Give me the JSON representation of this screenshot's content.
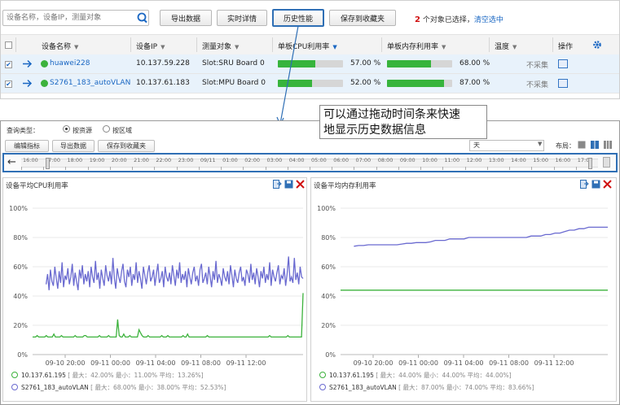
{
  "toolbar": {
    "search_placeholder": "设备名称，设备IP，测量对象",
    "export_label": "导出数据",
    "realtime_label": "实时详情",
    "history_label": "历史性能",
    "favorite_label": "保存到收藏夹",
    "selected_count": "2",
    "selected_text": " 个对象已选择，",
    "clear_label": "清空选中"
  },
  "table": {
    "columns": [
      "设备名称",
      "设备IP",
      "测量对象",
      "单板CPU利用率",
      "单板内存利用率",
      "温度",
      "操作"
    ],
    "rows": [
      {
        "name": "huawei228",
        "ip": "10.137.59.228",
        "object": "Slot:SRU Board 0",
        "cpu": "57.00 %",
        "cpu_pct": 57,
        "mem": "68.00 %",
        "mem_pct": 68,
        "temp": "不采集"
      },
      {
        "name": "S2761_183_autoVLAN",
        "ip": "10.137.61.183",
        "object": "Slot:MPU Board 0",
        "cpu": "52.00 %",
        "cpu_pct": 52,
        "mem": "87.00 %",
        "mem_pct": 87,
        "temp": "不采集"
      }
    ]
  },
  "callout": {
    "line1": "可以通过拖动时间条来快速",
    "line2": "地显示历史数据信息"
  },
  "query": {
    "label": "查询类型：",
    "by_resource": "按资源",
    "by_region": "按区域",
    "edit_label": "编辑指标",
    "export_label": "导出数据",
    "favorite_label": "保存到收藏夹",
    "period": "天",
    "layout_label": "布局："
  },
  "timeline": {
    "labels": [
      "16:00",
      "17:00",
      "18:00",
      "19:00",
      "20:00",
      "21:00",
      "22:00",
      "23:00",
      "09/11",
      "01:00",
      "02:00",
      "03:00",
      "04:00",
      "05:00",
      "06:00",
      "07:00",
      "08:00",
      "09:00",
      "10:00",
      "11:00",
      "12:00",
      "13:00",
      "14:00",
      "15:00",
      "16:00",
      "17:00"
    ]
  },
  "charts": {
    "cpu_title": "设备平均CPU利用率",
    "mem_title": "设备平均内存利用率",
    "cpu_legend": [
      {
        "name": "10.137.61.195",
        "stats": "[ 最大：42.00%  最小：11.00%  平均：13.26%]",
        "color": "#3cb23c"
      },
      {
        "name": "S2761_183_autoVLAN",
        "stats": "[ 最大：68.00%  最小：38.00%  平均：52.53%]",
        "color": "#6a6ad0"
      }
    ],
    "mem_legend": [
      {
        "name": "10.137.61.195",
        "stats": "[ 最大：44.00%  最小：44.00%  平均：44.00%]",
        "color": "#3cb23c"
      },
      {
        "name": "S2761_183_autoVLAN",
        "stats": "[ 最大：87.00%  最小：74.00%  平均：83.66%]",
        "color": "#6a6ad0"
      }
    ]
  },
  "chart_data": [
    {
      "type": "line",
      "title": "设备平均CPU利用率",
      "ylim": [
        0,
        100
      ],
      "yticks": [
        "0%",
        "20%",
        "40%",
        "60%",
        "80%",
        "100%"
      ],
      "xticks": [
        "09-10 20:00",
        "09-11 00:00",
        "09-11 04:00",
        "09-11 08:00",
        "09-11 12:00"
      ],
      "grid": true,
      "series": [
        {
          "name": "10.137.61.195",
          "color": "#3cb23c",
          "values": [
            12,
            12,
            12,
            13,
            12,
            12,
            12,
            12,
            12,
            13,
            12,
            12,
            12,
            12,
            14,
            12,
            12,
            12,
            12,
            13,
            12,
            12,
            12,
            12,
            12,
            12,
            12,
            12,
            13,
            12,
            12,
            12,
            12,
            12,
            13,
            13,
            12,
            12,
            12,
            12,
            12,
            12,
            12,
            12,
            13,
            12,
            12,
            12,
            12,
            12,
            13,
            12,
            12,
            12,
            12,
            12,
            24,
            13,
            12,
            12,
            14,
            12,
            12,
            12,
            13,
            12,
            12,
            12,
            12,
            12,
            17,
            15,
            13,
            12,
            12,
            12,
            13,
            12,
            12,
            12,
            12,
            12,
            12,
            12,
            12,
            13,
            12,
            12,
            12,
            13,
            12,
            12,
            12,
            12,
            12,
            12,
            12,
            12,
            12,
            13,
            12,
            12,
            14,
            12,
            12,
            12,
            12,
            12,
            12,
            12,
            12,
            12,
            12,
            12,
            12,
            13,
            12,
            12,
            12,
            12,
            12,
            12,
            12,
            12,
            12,
            12,
            12,
            12,
            12,
            12,
            12,
            12,
            12,
            12,
            12,
            12,
            12,
            12,
            12,
            12,
            12,
            12,
            12,
            12,
            12,
            12,
            12,
            12,
            12,
            12,
            12,
            12,
            12,
            12,
            12,
            12,
            13,
            12,
            12,
            12,
            12,
            12,
            12,
            12,
            12,
            12,
            12,
            12,
            13,
            12,
            12,
            12,
            12,
            12,
            12,
            12,
            12,
            12,
            42
          ]
        },
        {
          "name": "S2761_183_autoVLAN",
          "color": "#6a6ad0",
          "values": [
            48,
            55,
            44,
            58,
            50,
            47,
            60,
            52,
            45,
            57,
            49,
            63,
            46,
            54,
            51,
            59,
            48,
            53,
            62,
            47,
            56,
            50,
            44,
            58,
            52,
            61,
            48,
            55,
            50,
            57,
            46,
            60,
            53,
            49,
            64,
            51,
            56,
            45,
            58,
            52,
            47,
            61,
            54,
            50,
            57,
            48,
            66,
            52,
            45,
            59,
            53,
            49,
            57,
            62,
            50,
            46,
            58,
            53,
            60,
            47,
            55,
            51,
            63,
            49,
            57,
            52,
            45,
            60,
            54,
            48,
            56,
            61,
            50,
            53,
            58,
            47,
            55,
            62,
            49,
            52,
            57,
            46,
            60,
            53,
            50,
            56,
            48,
            61,
            54,
            47,
            58,
            52,
            63,
            49,
            55,
            51,
            57,
            46,
            59,
            53,
            48,
            56,
            60,
            50,
            54,
            47,
            58,
            62,
            49,
            52,
            56,
            48,
            60,
            53,
            46,
            57,
            51,
            64,
            49,
            55,
            52,
            47,
            59,
            53,
            50,
            57,
            48,
            61,
            54,
            46,
            58,
            52,
            49,
            56,
            60,
            50,
            53,
            47,
            58,
            55,
            49,
            62,
            51,
            56,
            48,
            59,
            53,
            46,
            57,
            52,
            60,
            49,
            55,
            51,
            63,
            47,
            58,
            53,
            50,
            56,
            61,
            48,
            54,
            52,
            59,
            47,
            55,
            67,
            50,
            53,
            49,
            66,
            51,
            56,
            48,
            60,
            53,
            52
          ]
        }
      ]
    },
    {
      "type": "line",
      "title": "设备平均内存利用率",
      "ylim": [
        0,
        100
      ],
      "yticks": [
        "0%",
        "20%",
        "40%",
        "60%",
        "80%",
        "100%"
      ],
      "xticks": [
        "09-10 20:00",
        "09-11 00:00",
        "09-11 04:00",
        "09-11 08:00",
        "09-11 12:00"
      ],
      "grid": true,
      "series": [
        {
          "name": "10.137.61.195",
          "color": "#3cb23c",
          "values": [
            44,
            44,
            44,
            44,
            44,
            44,
            44,
            44,
            44,
            44,
            44,
            44,
            44,
            44,
            44,
            44,
            44,
            44,
            44,
            44,
            44,
            44,
            44,
            44,
            44,
            44,
            44,
            44,
            44,
            44,
            44,
            44,
            44,
            44,
            44,
            44,
            44,
            44,
            44,
            44,
            44,
            44,
            44,
            44,
            44,
            44,
            44,
            44,
            44,
            44
          ]
        },
        {
          "name": "S2761_183_autoVLAN",
          "color": "#6a6ad0",
          "values": [
            74,
            74.5,
            74.5,
            75,
            75,
            75,
            75,
            75,
            75,
            75,
            75.5,
            76,
            76,
            76.5,
            76.5,
            76.5,
            77,
            78,
            78,
            78,
            79,
            79,
            79,
            79,
            80,
            80,
            80,
            80,
            80,
            80,
            80,
            80,
            80,
            80,
            80,
            80,
            80,
            81,
            81,
            81,
            82,
            82,
            83,
            83,
            84,
            85,
            85,
            86,
            86,
            87,
            87,
            87,
            87,
            87
          ]
        }
      ]
    }
  ]
}
